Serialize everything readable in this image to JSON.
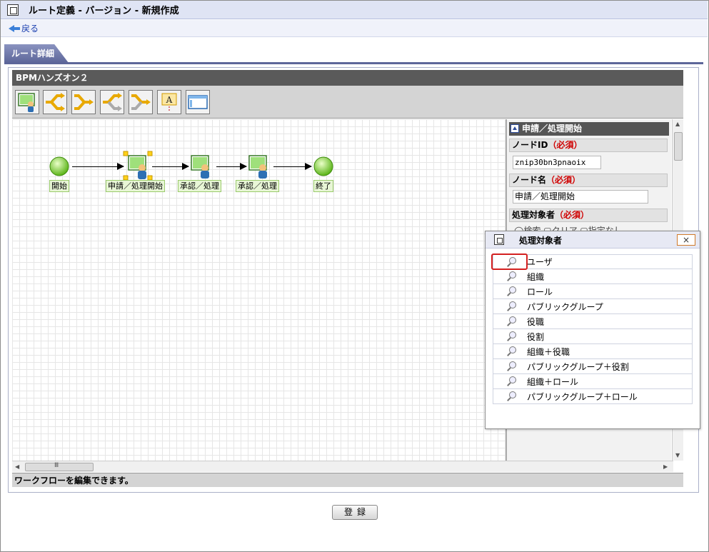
{
  "header": {
    "title": "ルート定義 - バージョン - 新規作成",
    "back_label": "戻る"
  },
  "tab": {
    "label": "ルート詳細"
  },
  "panel": {
    "title": "BPMハンズオン２"
  },
  "toolbar": {
    "tools": [
      {
        "icon": "process-node-icon"
      },
      {
        "icon": "branch-start-icon"
      },
      {
        "icon": "branch-end-icon"
      },
      {
        "icon": "split-icon"
      },
      {
        "icon": "merge-icon"
      },
      {
        "icon": "text-annotation-icon"
      },
      {
        "icon": "window-icon"
      }
    ]
  },
  "workflow": {
    "nodes": [
      {
        "type": "start",
        "label": "開始"
      },
      {
        "type": "process",
        "label": "申請／処理開始",
        "selected": true
      },
      {
        "type": "process",
        "label": "承認／処理"
      },
      {
        "type": "process",
        "label": "承認／処理"
      },
      {
        "type": "end",
        "label": "終了"
      }
    ]
  },
  "status": {
    "text": "ワークフローを編集できます。"
  },
  "props": {
    "header": "申請／処理開始",
    "node_id_label": "ノードID",
    "node_id_value": "znip30bn3pnaoix",
    "node_name_label": "ノード名",
    "node_name_value": "申請／処理開始",
    "target_label": "処理対象者",
    "required": "（必須）",
    "partial_text": "◯検索 ▢クリア ▢指定なし"
  },
  "popup": {
    "title": "処理対象者",
    "close": "×",
    "items": [
      "ユーザ",
      "組織",
      "ロール",
      "パブリックグループ",
      "役職",
      "役割",
      "組織＋役職",
      "パブリックグループ＋役割",
      "組織＋ロール",
      "パブリックグループ＋ロール"
    ]
  },
  "scroll": {
    "grip": "Ⅲ"
  },
  "footer": {
    "register_label": "登録"
  },
  "colors": {
    "header_bg": "#dfe4f4",
    "tab": "#5d6699",
    "highlight": "#d42020"
  }
}
